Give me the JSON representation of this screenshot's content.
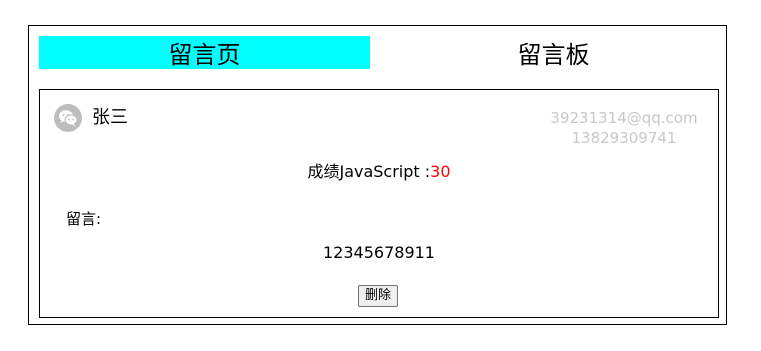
{
  "tabs": {
    "active_label": "留言页",
    "board_label": "留言板",
    "active_color": "#00ffff"
  },
  "entry": {
    "avatar_icon": "wechat-icon",
    "name": "张三",
    "email": "39231314@qq.com",
    "phone": "13829309741",
    "score_prefix": "成绩JavaScript :",
    "score_value": "30",
    "score_color": "#ff0000",
    "message_label": "留言:",
    "message_content": "12345678911",
    "delete_label": "删除"
  }
}
